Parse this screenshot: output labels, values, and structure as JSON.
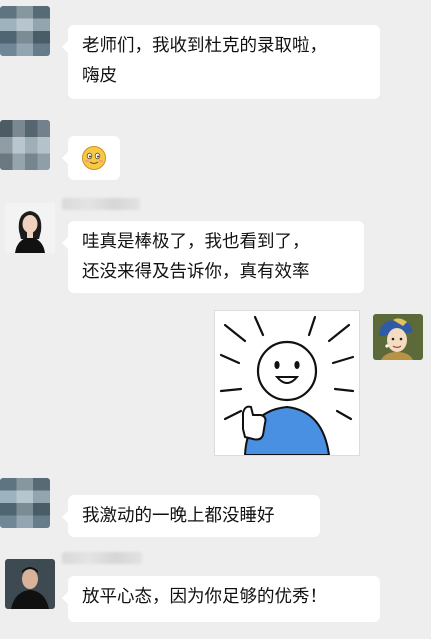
{
  "messages": [
    {
      "lines": [
        "老师们，我收到杜克的录取啦，",
        "嗨皮"
      ]
    },
    {
      "emoji_icon": "blushing-smile-emoji"
    },
    {
      "lines": [
        "哇真是棒极了，我也看到了，",
        "还没来得及告诉你，真有效率"
      ]
    },
    {
      "sticker_icon": "thumbs-up-smiley-sticker"
    },
    {
      "lines": [
        "我激动的一晚上都没睡好"
      ]
    },
    {
      "lines": [
        "放平心态，因为你足够的优秀！"
      ]
    }
  ],
  "colors": {
    "background": "#eeeeee",
    "bubble": "#ffffff",
    "sticker_shirt": "#4a90e2"
  }
}
